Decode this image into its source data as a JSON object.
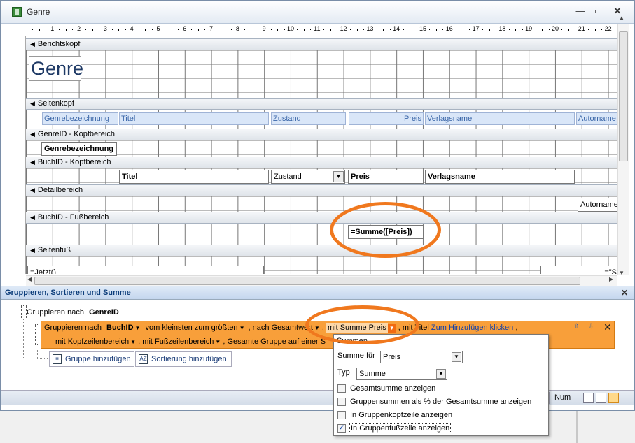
{
  "window": {
    "title": "Genre"
  },
  "ruler": {
    "numbers": [
      "1",
      "2",
      "3",
      "4",
      "5",
      "6",
      "7",
      "8",
      "9",
      "10",
      "11",
      "12",
      "13",
      "14",
      "15",
      "16",
      "17",
      "18",
      "19",
      "20",
      "21",
      "22"
    ]
  },
  "sections": {
    "berichtskopf": "Berichtskopf",
    "seitenkopf": "Seitenkopf",
    "genre_kopf": "GenreID - Kopfbereich",
    "buch_kopf": "BuchID - Kopfbereich",
    "detail": "Detailbereich",
    "buch_fuss": "BuchID - Fußbereich",
    "seitenfuss": "Seitenfuß"
  },
  "controls": {
    "report_title": "Genre",
    "page_header_labels": [
      "Genrebezeichnung",
      "Titel",
      "Zustand",
      "Preis",
      "Verlagsname",
      "Autorname"
    ],
    "genre_field": "Genrebezeichnung",
    "buch_fields": {
      "titel": "Titel",
      "zustand": "Zustand",
      "preis": "Preis",
      "verlag": "Verlagsname"
    },
    "detail_field": "Autorname",
    "sum_formula": "=Summe([Preis])",
    "footer_field": "=Jetzt()",
    "footer_right": "=\"S"
  },
  "group_panel": {
    "title": "Gruppieren, Sortieren und Summe",
    "row1": {
      "prefix": "Gruppieren nach",
      "field": "GenreID"
    },
    "row2": {
      "prefix": "Gruppieren nach",
      "field": "BuchID",
      "sort": "vom kleinsten zum größten",
      "gesamt": "nach Gesamtwert",
      "summe": "mit Summe Preis",
      "titel_prefix": "mit Titel",
      "titel_link": "Zum Hinzufügen klicken",
      "kopf": "mit Kopfzeilenbereich",
      "fuss": "mit Fußzeilenbereich",
      "gruppe": "Gesamte Gruppe auf einer S"
    },
    "add_group": "Gruppe hinzufügen",
    "add_sort": "Sortierung hinzufügen"
  },
  "popup": {
    "title": "Summen",
    "summe_fuer_label": "Summe für",
    "summe_fuer_value": "Preis",
    "typ_label": "Typ",
    "typ_value": "Summe",
    "options": [
      {
        "label": "Gesamtsumme anzeigen",
        "checked": false
      },
      {
        "label": "Gruppensummen als % der Gesamtsumme anzeigen",
        "checked": false
      },
      {
        "label": "In Gruppenkopfzeile anzeigen",
        "checked": false
      },
      {
        "label": "In Gruppenfußzeile anzeigen",
        "checked": true
      }
    ]
  },
  "statusbar": {
    "num": "Num"
  },
  "colors": {
    "accent": "#f0781e",
    "group_row": "#f89f3a",
    "header_blue": "#0c3d7a"
  }
}
